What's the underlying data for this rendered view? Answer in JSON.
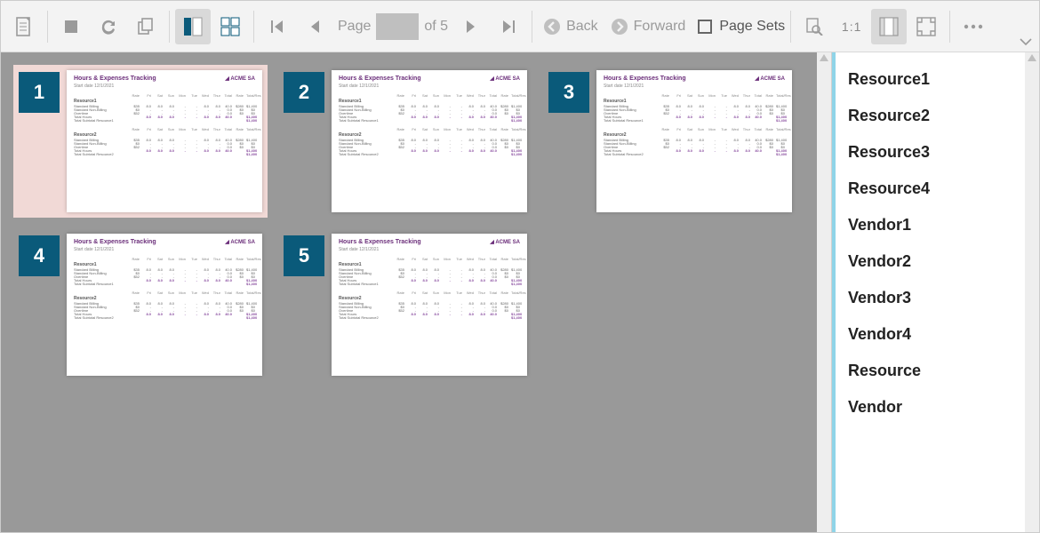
{
  "toolbar": {
    "page_label": "Page",
    "page_total": "of 5",
    "back": "Back",
    "forward": "Forward",
    "page_sets": "Page Sets",
    "zoom_ratio": "1:1"
  },
  "panel": {
    "items": [
      "Resource1",
      "Resource2",
      "Resource3",
      "Resource4",
      "Vendor1",
      "Vendor2",
      "Vendor3",
      "Vendor4",
      "Resource",
      "Vendor"
    ]
  },
  "report": {
    "title": "Hours & Expenses Tracking",
    "brand": "ACME SA",
    "start_label": "Start date",
    "start_value": "12/1/2021",
    "col_groups": [
      "Hours Fri - Thur",
      "Non Fri - Thur"
    ],
    "cols": [
      "Rate",
      "Fri",
      "Sat",
      "Sun",
      "Mon",
      "Tue",
      "Wed",
      "Thur",
      "Total",
      "Rate",
      "Total/Res"
    ],
    "sections": [
      {
        "name": "Resource1",
        "rows": [
          {
            "lbl": "Standard Billing",
            "c": [
              "$35",
              "8.0",
              "8.0",
              "8.0",
              "-",
              "-",
              "8.0",
              "8.0",
              "40.0",
              "$280",
              "$1,400"
            ]
          },
          {
            "lbl": "Standard Non-Billing",
            "c": [
              "$0",
              "-",
              "-",
              "-",
              "-",
              "-",
              "-",
              "-",
              "0.0",
              "$0",
              "$0"
            ]
          },
          {
            "lbl": "Overtime",
            "c": [
              "$52",
              "-",
              "-",
              "-",
              "-",
              "-",
              "-",
              "-",
              "0.0",
              "$0",
              "$0"
            ]
          },
          {
            "lbl": "Total Hours",
            "tot": true,
            "c": [
              "",
              "8.0",
              "8.0",
              "8.0",
              "-",
              "-",
              "8.0",
              "8.0",
              "40.0",
              "",
              "$1,400"
            ]
          },
          {
            "lbl": "Total Subtotal Resource1",
            "tot": true,
            "c": [
              "",
              "",
              "",
              "",
              "",
              "",
              "",
              "",
              "",
              "",
              "$1,400"
            ]
          }
        ]
      },
      {
        "name": "Resource2",
        "rows": [
          {
            "lbl": "Standard Billing",
            "c": [
              "$35",
              "8.0",
              "8.0",
              "8.0",
              "-",
              "-",
              "8.0",
              "8.0",
              "40.0",
              "$280",
              "$1,400"
            ]
          },
          {
            "lbl": "Standard Non-Billing",
            "c": [
              "$0",
              "-",
              "-",
              "-",
              "-",
              "-",
              "-",
              "-",
              "0.0",
              "$0",
              "$0"
            ]
          },
          {
            "lbl": "Overtime",
            "c": [
              "$52",
              "-",
              "-",
              "-",
              "-",
              "-",
              "-",
              "-",
              "0.0",
              "$0",
              "$0"
            ]
          },
          {
            "lbl": "Total Hours",
            "tot": true,
            "c": [
              "",
              "8.0",
              "8.0",
              "8.0",
              "-",
              "-",
              "8.0",
              "8.0",
              "40.0",
              "",
              "$1,400"
            ]
          },
          {
            "lbl": "Total Subtotal Resource2",
            "tot": true,
            "c": [
              "",
              "",
              "",
              "",
              "",
              "",
              "",
              "",
              "",
              "",
              "$1,400"
            ]
          }
        ]
      }
    ]
  },
  "thumbnails": [
    1,
    2,
    3,
    4,
    5
  ],
  "active_thumbnail": 1
}
